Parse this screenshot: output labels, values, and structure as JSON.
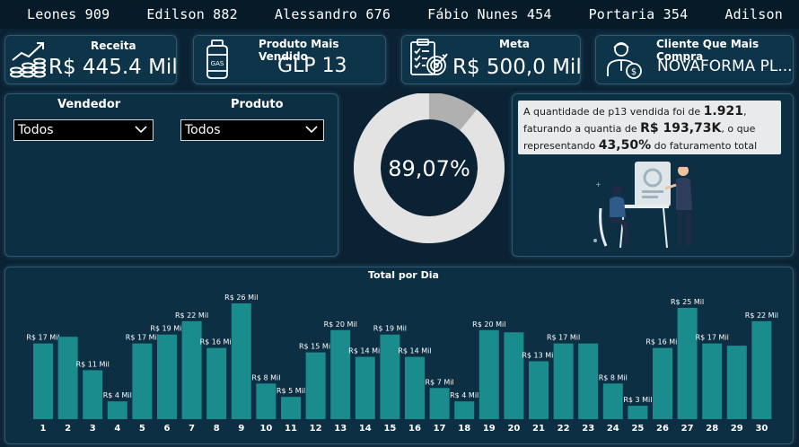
{
  "ticker": [
    {
      "name": "Leones",
      "value": "909"
    },
    {
      "name": "Edilson",
      "value": "882"
    },
    {
      "name": "Alessandro",
      "value": "676"
    },
    {
      "name": "Fábio Nunes",
      "value": "454"
    },
    {
      "name": "Portaria",
      "value": "354"
    },
    {
      "name": "Adilson",
      "value": ""
    }
  ],
  "kpis": {
    "receita": {
      "title": "Receita",
      "value": "R$ 445.4 Mil"
    },
    "produto": {
      "title": "Produto Mais Vendido",
      "value": "GLP 13",
      "icon_text": "GAS"
    },
    "meta": {
      "title": "Meta",
      "value": "R$ 500,0 Mil"
    },
    "cliente": {
      "title": "Cliente Que Mais Compra",
      "value": "NOVAFORMA PL..."
    }
  },
  "filters": {
    "vendedor": {
      "label": "Vendedor",
      "selected": "Todos"
    },
    "produto": {
      "label": "Produto",
      "selected": "Todos"
    }
  },
  "donut": {
    "percent": 89.07,
    "label": "89,07%"
  },
  "info": {
    "t1": "A quantidade de p13 vendida foi de ",
    "b1": "1.921",
    "t2": ", faturando a quantia de ",
    "b2": "R$ 193,73K",
    "t3": ", o que representando ",
    "b3": "43,50%",
    "t4": " do faturamento total"
  },
  "colors": {
    "bar": "#1a8c8e",
    "accent": "#0e3449",
    "donut_main": "#e3e3e3",
    "donut_rest": "#b0b0b0"
  },
  "chart_data": {
    "type": "bar",
    "title": "Total por Dia",
    "categories": [
      "1",
      "2",
      "3",
      "4",
      "5",
      "6",
      "7",
      "8",
      "9",
      "10",
      "11",
      "12",
      "13",
      "14",
      "15",
      "16",
      "17",
      "18",
      "19",
      "20",
      "21",
      "22",
      "23",
      "24",
      "25",
      "26",
      "27",
      "28",
      "29",
      "30"
    ],
    "values": [
      17,
      18.5,
      11,
      4,
      17,
      19,
      22,
      16,
      26,
      8,
      5,
      15,
      20,
      14,
      19,
      14,
      7,
      4,
      20,
      19.5,
      13,
      17,
      17,
      8,
      3,
      16,
      25,
      17,
      16.5,
      22
    ],
    "labels": [
      "R$ 17 Mil",
      "",
      "R$ 11 Mil",
      "R$ 4 Mil",
      "R$ 17 Mil",
      "R$ 19 Mil",
      "R$ 22 Mil",
      "R$ 16 Mil",
      "R$ 26 Mil",
      "R$ 8 Mil",
      "R$ 5 Mil",
      "R$ 15 Mil",
      "R$ 20 Mil",
      "R$ 14 Mil",
      "R$ 19 Mil",
      "R$ 14 Mil",
      "R$ 7 Mil",
      "R$ 4 Mil",
      "R$ 20 Mil",
      "",
      "R$ 13 Mil",
      "R$ 17 Mil",
      "",
      "R$ 8 Mil",
      "R$ 3 Mil",
      "R$ 16 Mil",
      "R$ 25 Mil",
      "R$ 17 Mil",
      "",
      "R$ 22 Mil"
    ],
    "ylim": [
      0,
      26
    ]
  }
}
